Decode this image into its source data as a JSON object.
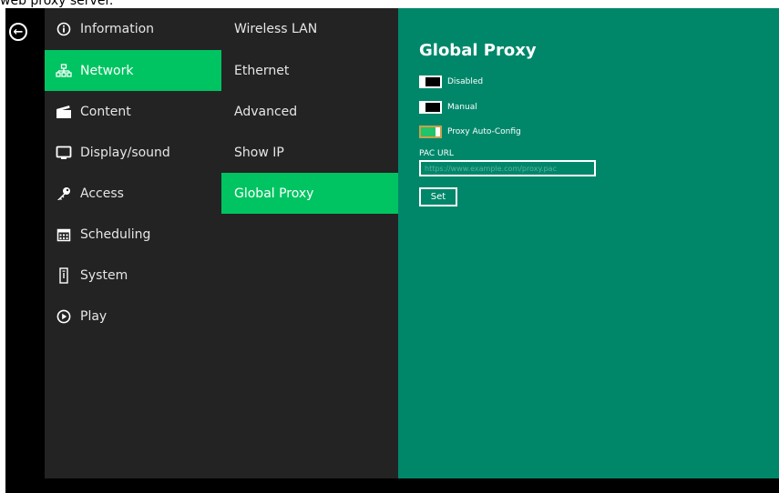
{
  "caption": "web proxy server.",
  "sidebar": {
    "back_icon": "arrow-left-circle-icon",
    "items": [
      {
        "label": "Information",
        "icon": "info-icon",
        "active": false
      },
      {
        "label": "Network",
        "icon": "network-icon",
        "active": true
      },
      {
        "label": "Content",
        "icon": "clapperboard-icon",
        "active": false
      },
      {
        "label": "Display/sound",
        "icon": "monitor-icon",
        "active": false
      },
      {
        "label": "Access",
        "icon": "key-icon",
        "active": false
      },
      {
        "label": "Scheduling",
        "icon": "calendar-icon",
        "active": false
      },
      {
        "label": "System",
        "icon": "tower-icon",
        "active": false
      },
      {
        "label": "Play",
        "icon": "play-circle-icon",
        "active": false
      }
    ]
  },
  "submenu": {
    "items": [
      {
        "label": "Wireless LAN",
        "active": false
      },
      {
        "label": "Ethernet",
        "active": false
      },
      {
        "label": "Advanced",
        "active": false
      },
      {
        "label": "Show IP",
        "active": false
      },
      {
        "label": "Global Proxy",
        "active": true
      }
    ]
  },
  "panel": {
    "title": "Global Proxy",
    "options": [
      {
        "label": "Disabled",
        "on": false
      },
      {
        "label": "Manual",
        "on": false
      },
      {
        "label": "Proxy Auto-Config",
        "on": true
      }
    ],
    "pac_url_label": "PAC URL",
    "pac_url_value": "",
    "pac_url_placeholder": "https://www.example.com/proxy.pac",
    "set_label": "Set"
  },
  "colors": {
    "accent": "#00c461",
    "panel_bg": "#00876a",
    "menu_bg": "#232323"
  }
}
